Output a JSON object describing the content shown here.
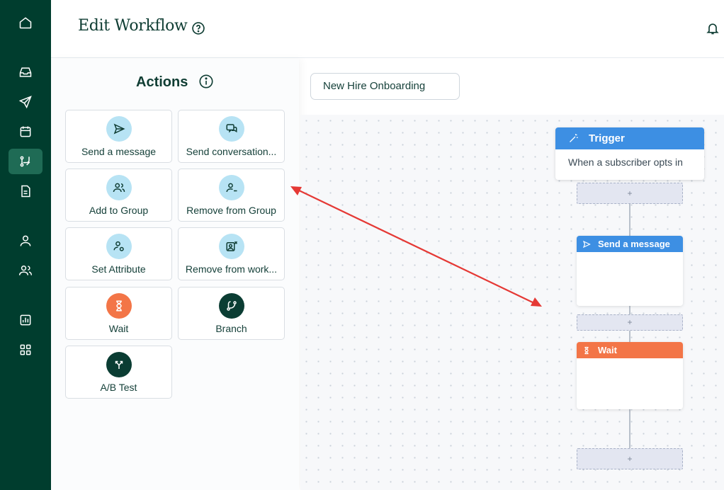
{
  "header": {
    "title": "Edit Workflow",
    "help_icon": "help-circle-icon",
    "bell_icon": "bell-icon"
  },
  "nav": {
    "items": [
      {
        "icon": "home-icon"
      },
      {
        "icon": "inbox-icon"
      },
      {
        "icon": "send-icon"
      },
      {
        "icon": "calendar-icon"
      },
      {
        "icon": "workflow-icon",
        "active": true
      },
      {
        "icon": "document-icon"
      },
      {
        "icon": "user-icon"
      },
      {
        "icon": "users-icon"
      },
      {
        "icon": "chart-icon"
      },
      {
        "icon": "apps-icon"
      }
    ]
  },
  "actions": {
    "title": "Actions",
    "cards": [
      {
        "label": "Send a message",
        "icon": "send-icon"
      },
      {
        "label": "Send conversation...",
        "icon": "chat-icon"
      },
      {
        "label": "Add to Group",
        "icon": "users-icon"
      },
      {
        "label": "Remove from Group",
        "icon": "user-minus-icon"
      },
      {
        "label": "Set Attribute",
        "icon": "user-tag-icon"
      },
      {
        "label": "Remove from work...",
        "icon": "remove-image-icon"
      },
      {
        "label": "Wait",
        "icon": "hourglass-icon"
      },
      {
        "label": "Branch",
        "icon": "branch-icon"
      },
      {
        "label": "A/B Test",
        "icon": "split-icon"
      }
    ]
  },
  "workflow": {
    "name": "New Hire Onboarding",
    "trigger": {
      "title": "Trigger",
      "description": "When a subscriber opts in"
    },
    "add_label": "+",
    "steps": [
      {
        "title": "Send a message",
        "icon": "send-icon"
      },
      {
        "title": "Wait",
        "icon": "hourglass-icon"
      }
    ]
  },
  "colors": {
    "nav": "#003d2e",
    "blue": "#3d8fe3",
    "orange": "#f37547",
    "annotation_arrow": "#e53935"
  }
}
